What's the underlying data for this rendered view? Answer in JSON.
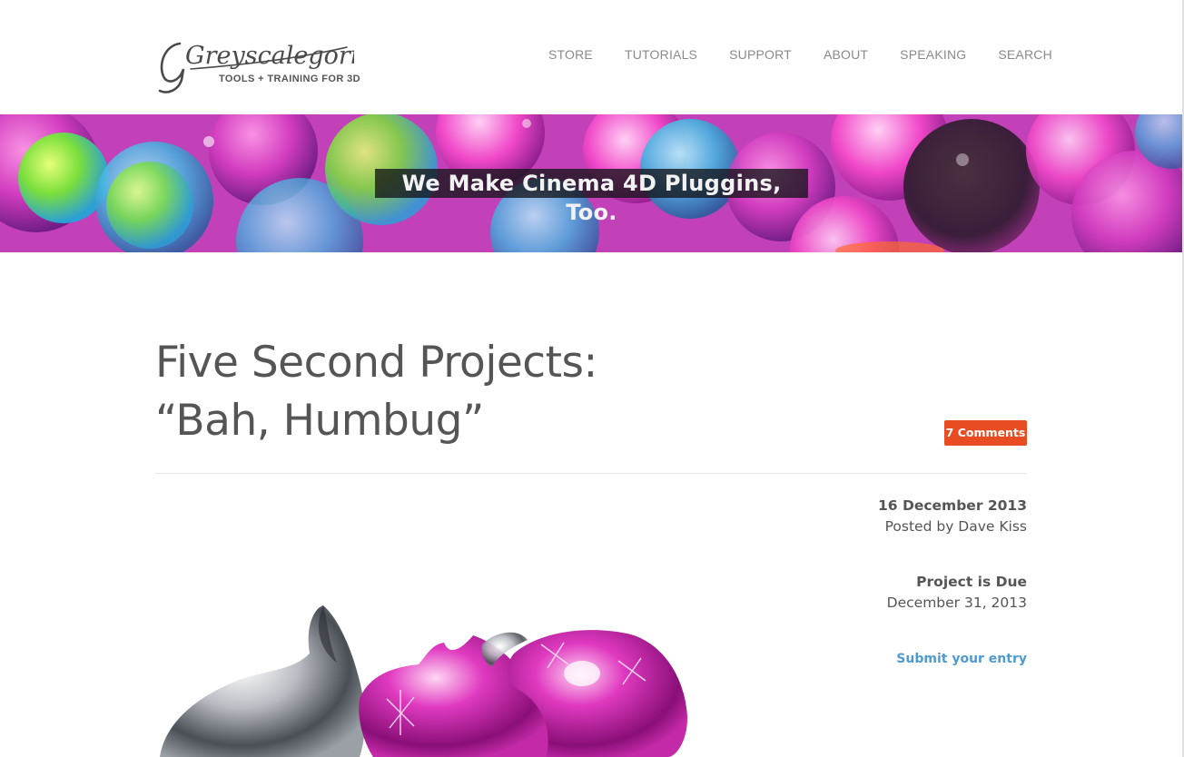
{
  "header": {
    "logo_text": "Greyscalegorilla",
    "logo_tagline": "TOOLS + TRAINING FOR 3D",
    "nav": [
      {
        "label": "STORE"
      },
      {
        "label": "TUTORIALS"
      },
      {
        "label": "SUPPORT"
      },
      {
        "label": "ABOUT"
      },
      {
        "label": "SPEAKING"
      },
      {
        "label": "SEARCH"
      }
    ]
  },
  "banner": {
    "caption": "We Make Cinema 4D Pluggins, Too."
  },
  "post": {
    "title": "Five Second Projects: “Bah, Humbug”",
    "comments_label": "7 Comments",
    "date": "16 December 2013",
    "author": "Posted by Dave Kiss",
    "due_label": "Project is Due",
    "due_date": "December 31, 2013",
    "submit_label": "Submit your entry"
  },
  "colors": {
    "accent_orange": "#e84c22",
    "link_blue": "#4f9ad1",
    "text": "#555555",
    "nav_text": "#8a8a8a"
  },
  "icons": [
    "broken-ornament-image"
  ]
}
